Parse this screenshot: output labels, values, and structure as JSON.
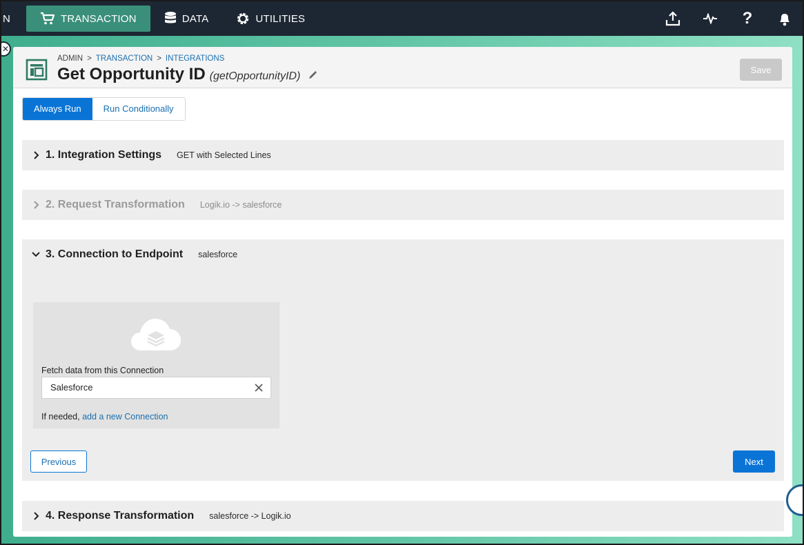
{
  "nav": {
    "edge_text": "N",
    "items": [
      {
        "label": "TRANSACTION",
        "icon": "cart-icon",
        "active": true
      },
      {
        "label": "DATA",
        "icon": "database-icon",
        "active": false
      },
      {
        "label": "UTILITIES",
        "icon": "gear-icon",
        "active": false
      }
    ],
    "right_icons": [
      "upload-icon",
      "activity-icon",
      "help-icon",
      "bell-icon"
    ]
  },
  "header": {
    "breadcrumb": [
      "ADMIN",
      "TRANSACTION",
      "INTEGRATIONS"
    ],
    "title": "Get Opportunity ID",
    "subtitle": "(getOpportunityID)",
    "save_label": "Save"
  },
  "run_toggle": {
    "always": "Always Run",
    "conditional": "Run Conditionally"
  },
  "sections": [
    {
      "title": "1. Integration Settings",
      "note": "GET with Selected Lines",
      "expanded": false
    },
    {
      "title": "2. Request Transformation",
      "note": "Logik.io -> salesforce",
      "expanded": false,
      "disabled": true
    },
    {
      "title": "3. Connection to Endpoint",
      "note": "salesforce",
      "expanded": true
    },
    {
      "title": "4. Response Transformation",
      "note": "salesforce -> Logik.io",
      "expanded": false
    }
  ],
  "connection": {
    "fetch_label": "Fetch data from this Connection",
    "value": "Salesforce",
    "if_needed": "If needed,",
    "add_link": "add a new Connection"
  },
  "buttons": {
    "previous": "Previous",
    "next": "Next"
  },
  "colors": {
    "nav_bg": "#1d2733",
    "nav_active": "#3a8f7a",
    "primary": "#0a74d6",
    "link": "#1a6fb0",
    "section_bg": "#ededed"
  }
}
